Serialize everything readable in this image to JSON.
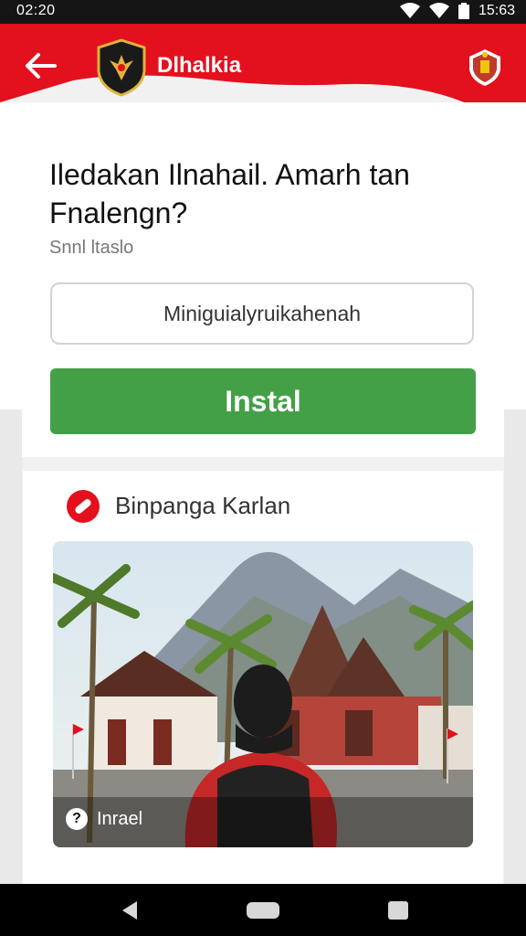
{
  "status_bar": {
    "time_left": "02:20",
    "time_right": "15:63"
  },
  "header": {
    "app_title": "Dlhalkia",
    "brand_color": "#e3101e"
  },
  "main": {
    "headline": "Iledakan Ilnahail. Amarh tan Fnalengn?",
    "subtitle": "Snnl ltaslo",
    "input_value": "Miniguialyruikahenah",
    "install_label": "Instal",
    "install_color": "#43a047"
  },
  "section": {
    "title": "Binpanga Karlan",
    "photo_caption": "Inrael",
    "caption_icon": "?"
  },
  "icons": {
    "back": "arrow-left-icon",
    "logo": "emblem-logo",
    "crest": "crest-icon",
    "section": "no-entry-icon"
  }
}
